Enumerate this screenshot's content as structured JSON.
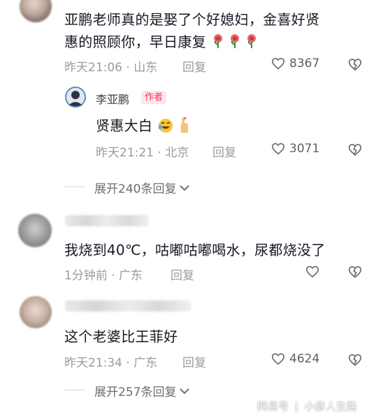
{
  "comments": [
    {
      "text_line1": "亚鹏老师真的是娶了个好媳妇，金喜好贤",
      "text_line2": "惠的照顾你，早日康复",
      "time_location": "昨天21:06 · 山东",
      "reply_label": "回复",
      "likes": "8367",
      "emoji": "rose-emoji"
    },
    {
      "nickname": "李亚鹏",
      "badge": "作者",
      "text": "贤惠大白",
      "time_location": "昨天21:21 · 北京",
      "reply_label": "回复",
      "likes": "3071",
      "emoji": "laughing-emoji"
    },
    {
      "text": "我烧到40℃，咕嘟咕嘟喝水，尿都烧没了",
      "time_location": "1分钟前 · 广东",
      "reply_label": "回复"
    },
    {
      "text": "这个老婆比王菲好",
      "time_location": "昨天21:34 · 广东",
      "reply_label": "回复",
      "likes": "4624"
    }
  ],
  "expand_replies": [
    {
      "label": "展开240条回复"
    },
    {
      "label": "展开257条回复"
    }
  ],
  "watermark": {
    "source": "网易号",
    "separator": "|",
    "author": "小彦人生路"
  },
  "colors": {
    "accent_red": "#fe2c55",
    "meta_gray": "#9a9ba0",
    "text_dark": "#161823"
  }
}
